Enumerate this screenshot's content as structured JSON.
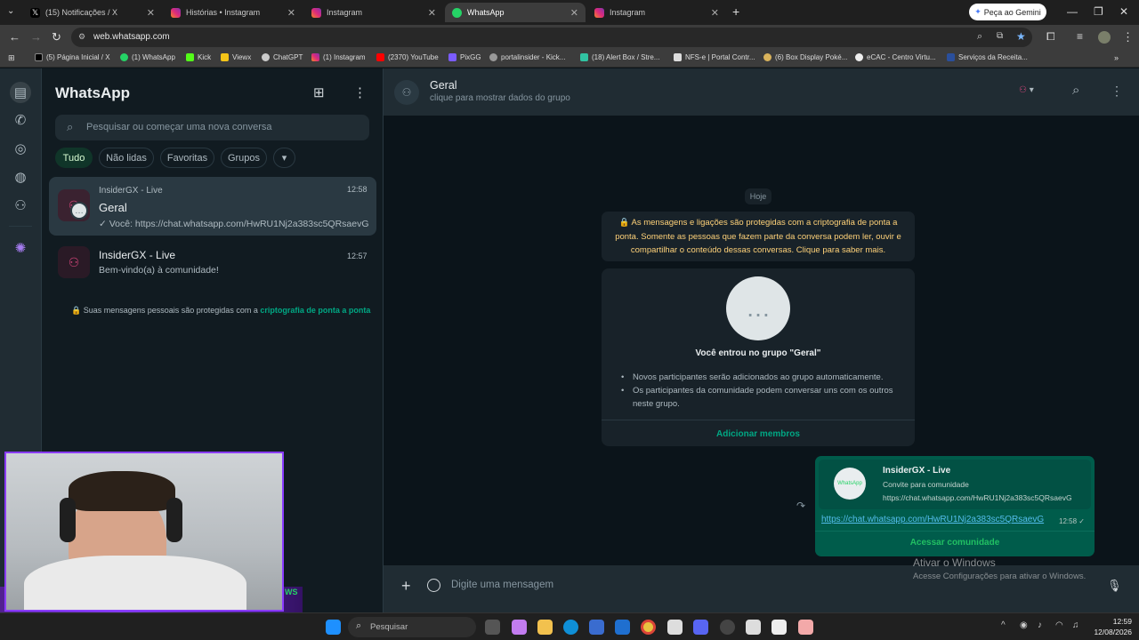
{
  "browser": {
    "tabs": [
      {
        "label": "(15) Notificações / X",
        "icon": "x-icon",
        "color": "#ffffff"
      },
      {
        "label": "Histórias • Instagram",
        "icon": "instagram-icon",
        "color": "#e1306c"
      },
      {
        "label": "Instagram",
        "icon": "instagram-icon",
        "color": "#e1306c"
      },
      {
        "label": "WhatsApp",
        "icon": "whatsapp-icon",
        "color": "#25d366"
      },
      {
        "label": "Instagram",
        "icon": "instagram-icon",
        "color": "#e1306c"
      }
    ],
    "active_tab_index": 3,
    "new_tab": "+",
    "gemini_button": "Peça ao Gemini",
    "url": "web.whatsapp.com",
    "bookmarks": [
      "(5) Página Inicial / X",
      "(1) WhatsApp",
      "Kick",
      "Viewx",
      "ChatGPT",
      "(1) Instagram",
      "(2370) YouTube",
      "PixGG",
      "portalinsider - Kick...",
      "(18) Alert Box / Stre...",
      "NFS-e | Portal Contr...",
      "(6) Box Display Poké...",
      "eCAC - Centro Virtu...",
      "Serviços da Receita..."
    ],
    "bookmark_colors": [
      "#ffffff",
      "#25d366",
      "#53fc18",
      "#f5c518",
      "#cccccc",
      "#e1306c",
      "#ff0000",
      "#7b5cff",
      "#cccccc",
      "#31c3a2",
      "#cccccc",
      "#d9b35c",
      "#cccccc",
      "#2a4f9c"
    ]
  },
  "whatsapp": {
    "title": "WhatsApp",
    "search_placeholder": "Pesquisar ou começar uma nova conversa",
    "filters": [
      "Tudo",
      "Não lidas",
      "Favoritas",
      "Grupos"
    ],
    "active_filter": "Tudo",
    "chats": [
      {
        "community": "InsiderGX - Live",
        "name": "Geral",
        "time": "12:58",
        "preview": "✓ Você: https://chat.whatsapp.com/HwRU1Nj2a383sc5QRsaevG"
      },
      {
        "name": "InsiderGX - Live",
        "time": "12:57",
        "preview": "Bem-vindo(a) à comunidade!"
      }
    ],
    "encryption_note_prefix": "🔒 Suas mensagens pessoais são protegidas com a ",
    "encryption_note_link": "criptografia de ponta a ponta",
    "conversation": {
      "name": "Geral",
      "subtitle": "clique para mostrar dados do grupo",
      "date_badge": "Hoje",
      "system_message": "🔒 As mensagens e ligações são protegidas com a criptografia de ponta a ponta. Somente as pessoas que fazem parte da conversa podem ler, ouvir e compartilhar o conteúdo dessas conversas. Clique para saber mais.",
      "joined_title": "Você entrou no grupo \"Geral\"",
      "joined_bullets": [
        "Novos participantes serão adicionados ao grupo automaticamente.",
        "Os participantes da comunidade podem conversar uns com os outros neste grupo."
      ],
      "add_members": "Adicionar membros",
      "sent_message": {
        "card_title": "InsiderGX - Live",
        "card_subtitle": "Convite para comunidade",
        "card_url": "https://chat.whatsapp.com/HwRU1Nj2a383sc5QRsaevG",
        "link": "https://chat.whatsapp.com/HwRU1Nj2a383sc5QRsaevG",
        "time": "12:58",
        "status": "✓",
        "action": "Acessar comunidade",
        "logo_text": "WhatsApp"
      },
      "composer_placeholder": "Digite uma mensagem"
    }
  },
  "overlay": {
    "activate_title": "Ativar o Windows",
    "activate_sub": "Acesse Configurações para ativar o Windows.",
    "webcam_tag": "WS"
  },
  "taskbar": {
    "search_placeholder": "Pesquisar",
    "time": "12:59",
    "date": "12/08/2026"
  },
  "colors": {
    "accent": "#00a884",
    "link": "#53bdeb",
    "system_text": "#ffd279",
    "bubble_out": "#005c4b"
  }
}
